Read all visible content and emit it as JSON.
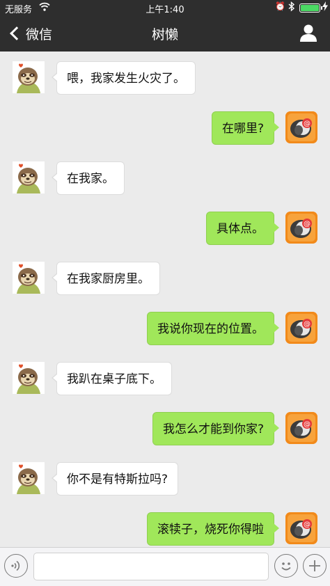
{
  "status_bar": {
    "carrier": "无服务",
    "time": "上午1:40",
    "battery_level": 1.0
  },
  "nav": {
    "back_label": "微信",
    "title": "树懒",
    "icons": [
      "chevron-left-icon",
      "person-icon"
    ]
  },
  "messages": [
    {
      "side": "left",
      "text": "喂，我家发生火灾了。"
    },
    {
      "side": "right",
      "text": "在哪里?"
    },
    {
      "side": "left",
      "text": "在我家。"
    },
    {
      "side": "right",
      "text": "具体点。"
    },
    {
      "side": "left",
      "text": "在我家厨房里。"
    },
    {
      "side": "right",
      "text": "我说你现在的位置。"
    },
    {
      "side": "left",
      "text": "我趴在桌子底下。"
    },
    {
      "side": "right",
      "text": "我怎么才能到你家?"
    },
    {
      "side": "left",
      "text": "你不是有特斯拉吗?"
    },
    {
      "side": "right",
      "text": "滚犊子，烧死你得啦"
    }
  ],
  "input_bar": {
    "value": "",
    "icons": [
      "voice-icon",
      "emoji-icon",
      "plus-icon"
    ]
  },
  "colors": {
    "header_bg": "#2e2e2e",
    "chat_bg": "#ebebeb",
    "sent_bubble": "#a0e75a",
    "received_bubble": "#ffffff"
  }
}
